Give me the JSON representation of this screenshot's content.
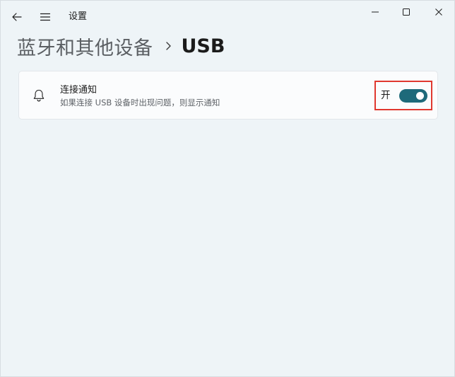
{
  "window": {
    "app_title": "设置",
    "controls": {
      "minimize_icon": "minimize-icon",
      "maximize_icon": "maximize-icon",
      "close_icon": "close-icon"
    }
  },
  "nav": {
    "back_icon": "back-arrow-icon",
    "menu_icon": "hamburger-menu-icon"
  },
  "breadcrumb": {
    "parent": "蓝牙和其他设备",
    "separator_icon": "chevron-right-icon",
    "current": "USB"
  },
  "settings": [
    {
      "icon": "bell-icon",
      "title": "连接通知",
      "description": "如果连接 USB 设备时出现问题，则显示通知",
      "toggle_label": "开",
      "toggle_on": true
    }
  ],
  "colors": {
    "accent": "#1e6a7a",
    "highlight_border": "#e0382f",
    "background": "#eef4f7",
    "card": "#fbfcfd"
  }
}
